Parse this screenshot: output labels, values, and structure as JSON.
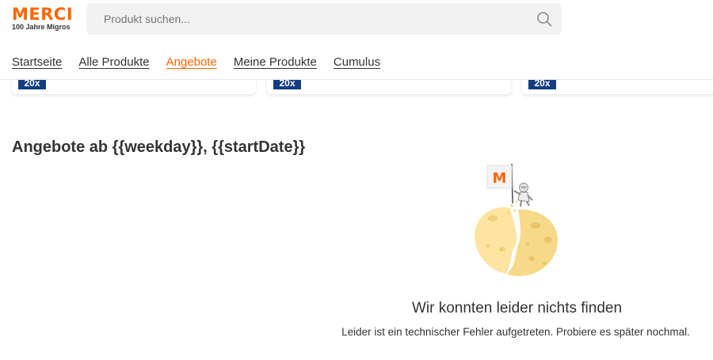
{
  "header": {
    "logo_title": "MERCI",
    "logo_subtitle": "100 Jahre Migros",
    "search_placeholder": "Produkt suchen..."
  },
  "nav": {
    "items": [
      {
        "label": "Startseite",
        "active": false
      },
      {
        "label": "Alle Produkte",
        "active": false
      },
      {
        "label": "Angebote",
        "active": true
      },
      {
        "label": "Meine Produkte",
        "active": false
      },
      {
        "label": "Cumulus",
        "active": false
      }
    ]
  },
  "offer_cards": [
    {
      "badge": "20x"
    },
    {
      "badge": "20x"
    },
    {
      "badge": "20x"
    }
  ],
  "section_title": "Angebote ab {{weekday}}, {{startDate}}",
  "empty_state": {
    "title": "Wir konnten leider nichts finden",
    "message": "Leider ist ein technischer Fehler aufgetreten. Probiere es später nochmal.",
    "flag_letter": "M"
  },
  "colors": {
    "accent": "#ff6600",
    "badge": "#133d83",
    "text": "#333333",
    "search_bg": "#f2f2f2",
    "cheese": "#fde5a1"
  },
  "icons": {
    "search": "search-icon",
    "illustration": "cheese-moon-illustration"
  }
}
